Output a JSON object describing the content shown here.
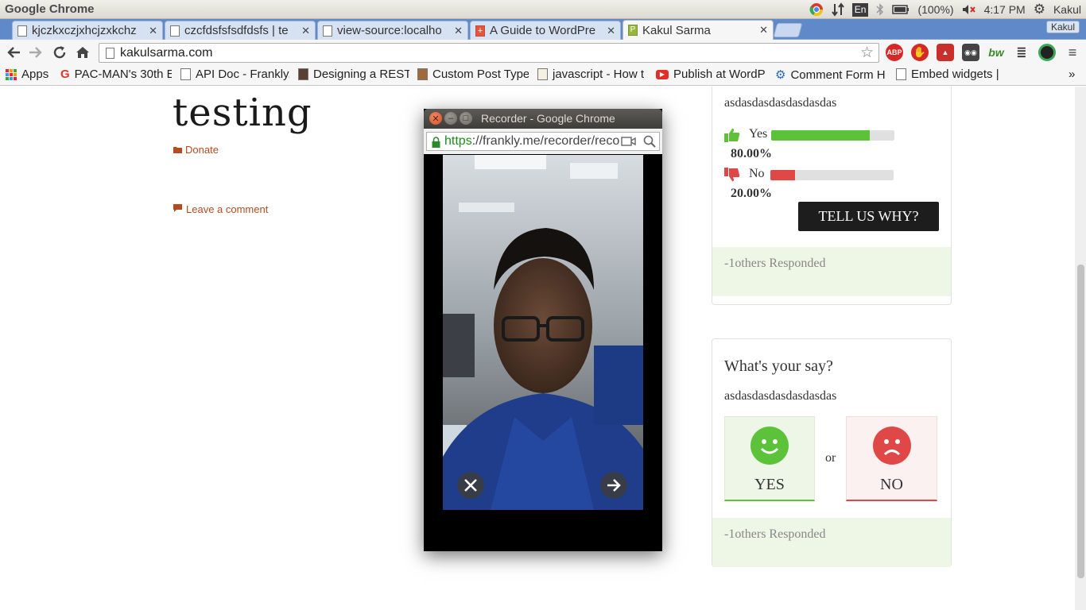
{
  "system_bar": {
    "app_name": "Google Chrome",
    "keyboard": "En",
    "battery": "(100%)",
    "time": "4:17 PM",
    "user": "Kakul"
  },
  "tabs": [
    {
      "title": "kjczkxczjxhcjzxkchz",
      "active": false
    },
    {
      "title": "czcfdsfsfsdfdsfs | te",
      "active": false
    },
    {
      "title": "view-source:localho",
      "active": false
    },
    {
      "title": "A Guide to WordPre",
      "active": false
    },
    {
      "title": "Kakul Sarma",
      "active": true
    }
  ],
  "profile_badge": "Kakul",
  "address_bar": {
    "url": "kakulsarma.com"
  },
  "extensions": [
    "adblock-plus-icon",
    "stop-icon",
    "extension-red-icon",
    "extension-glasses-icon",
    "bw-icon",
    "extension-tree-icon",
    "chrome-circle-icon"
  ],
  "extension_labels": {
    "abp": "ABP",
    "bw": "bw"
  },
  "bookmarks": {
    "apps_label": "Apps",
    "items": [
      "PAC-MAN's 30th E",
      "API Doc - Frankly.",
      "Designing a REST",
      "Custom Post Type",
      "javascript - How t",
      "Publish at WordP",
      "Comment Form H",
      "Embed widgets |"
    ],
    "overflow": "»"
  },
  "page": {
    "post_title": "testing",
    "category_link": "Donate",
    "comment_link": "Leave a comment"
  },
  "poll1": {
    "question": "asdasdasdasdasdasdas",
    "options": [
      {
        "label": "Yes",
        "percent_text": "80.00%",
        "fraction": 0.8,
        "color": "#5cc23a"
      },
      {
        "label": "No",
        "percent_text": "20.00%",
        "fraction": 0.2,
        "color": "#e04848"
      }
    ],
    "cta": "TELL US WHY?",
    "responded": "-1others Responded"
  },
  "poll2": {
    "heading": "What's your say?",
    "question": "asdasdasdasdasdasdas",
    "yes_label": "YES",
    "or_label": "or",
    "no_label": "NO",
    "responded": "-1others Responded"
  },
  "popup": {
    "title": "Recorder - Google Chrome",
    "url_scheme": "https",
    "url_rest": "://frankly.me/recorder/reco"
  }
}
